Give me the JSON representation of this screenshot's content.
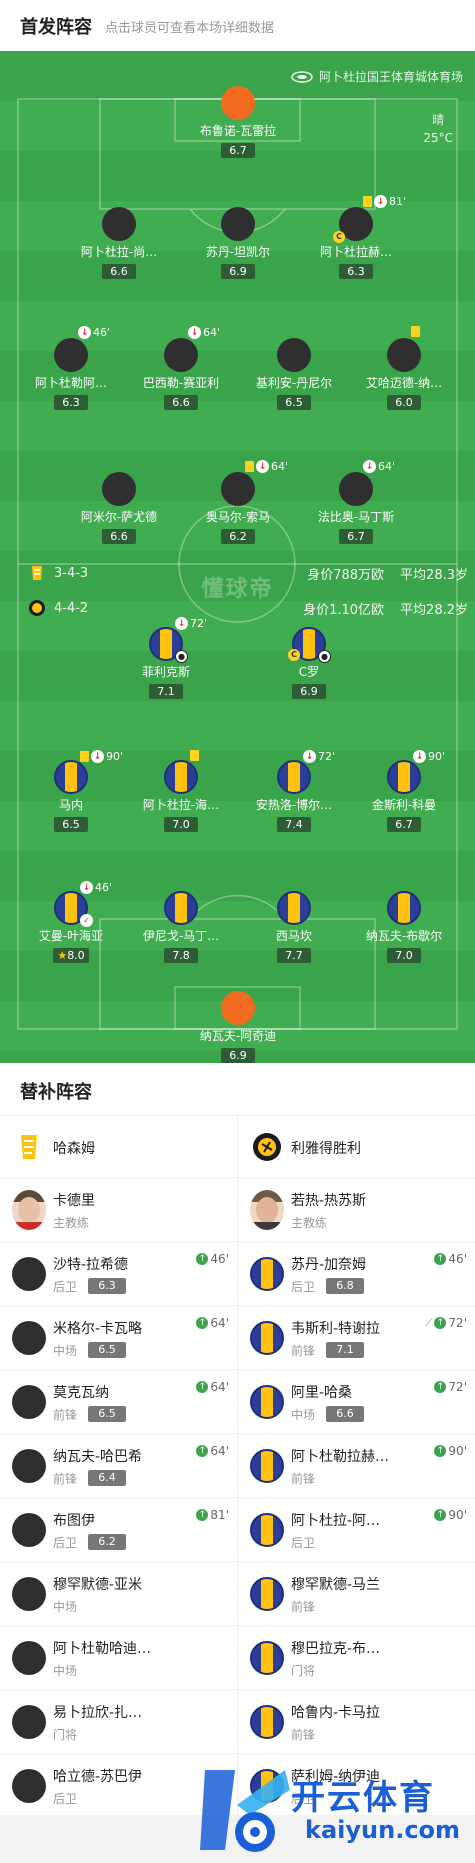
{
  "header": {
    "title": "首发阵容",
    "subtitle": "点击球员可查看本场详细数据"
  },
  "venue": {
    "name": "阿卜杜拉国王体育城体育场"
  },
  "weather": {
    "condition": "晴",
    "temp": "25°C"
  },
  "watermark_mid": "懂球帝",
  "home_team": {
    "formation": "3-4-3",
    "value": "身价788万欧",
    "avg_age": "平均28.3岁"
  },
  "away_team": {
    "formation": "4-4-2",
    "value": "身价1.10亿欧",
    "avg_age": "平均28.2岁"
  },
  "home_players": [
    {
      "name": "布鲁诺-瓦雷拉",
      "rating": "6.7"
    },
    {
      "name": "阿卜杜拉-尚…",
      "rating": "6.6"
    },
    {
      "name": "苏丹-坦凯尔",
      "rating": "6.9"
    },
    {
      "name": "阿卜杜拉赫…",
      "rating": "6.3",
      "event": "81'"
    },
    {
      "name": "阿卜杜勒阿…",
      "rating": "6.3",
      "event": "46'"
    },
    {
      "name": "巴西勒-赛亚利",
      "rating": "6.6",
      "event": "64'"
    },
    {
      "name": "基利安-丹尼尔",
      "rating": "6.5"
    },
    {
      "name": "艾哈迈德-纳…",
      "rating": "6.0"
    },
    {
      "name": "阿米尔-萨尤德",
      "rating": "6.6"
    },
    {
      "name": "奥马尔-索马",
      "rating": "6.2",
      "event": "64'"
    },
    {
      "name": "法比奥-马丁斯",
      "rating": "6.7",
      "event": "64'"
    }
  ],
  "away_players": [
    {
      "name": "菲利克斯",
      "rating": "7.1",
      "event": "72'"
    },
    {
      "name": "C罗",
      "rating": "6.9"
    },
    {
      "name": "马内",
      "rating": "6.5",
      "event": "90'"
    },
    {
      "name": "阿卜杜拉-海…",
      "rating": "7.0"
    },
    {
      "name": "安热洛-博尔…",
      "rating": "7.4",
      "event": "72'"
    },
    {
      "name": "金斯利-科曼",
      "rating": "6.7",
      "event": "90'"
    },
    {
      "name": "艾曼-叶海亚",
      "rating": "8.0",
      "event": "46'"
    },
    {
      "name": "伊尼戈-马丁…",
      "rating": "7.8"
    },
    {
      "name": "西马坎",
      "rating": "7.7"
    },
    {
      "name": "纳瓦夫-布歇尔",
      "rating": "7.0"
    },
    {
      "name": "纳瓦夫-阿奇迪",
      "rating": "6.9"
    }
  ],
  "subs": {
    "title": "替补阵容",
    "left": {
      "team": "哈森姆",
      "coach": {
        "name": "卡德里",
        "role": "主教练"
      },
      "players": [
        {
          "name": "沙特-拉希德",
          "pos": "后卫",
          "rating": "6.3",
          "in": "46'"
        },
        {
          "name": "米格尔-卡瓦略",
          "pos": "中场",
          "rating": "6.5",
          "in": "64'"
        },
        {
          "name": "莫克瓦纳",
          "pos": "前锋",
          "rating": "6.5",
          "in": "64'"
        },
        {
          "name": "纳瓦夫-哈巴希",
          "pos": "前锋",
          "rating": "6.4",
          "in": "64'"
        },
        {
          "name": "布图伊",
          "pos": "后卫",
          "rating": "6.2",
          "in": "81'"
        },
        {
          "name": "穆罕默德-亚米",
          "pos": "中场",
          "rating": "",
          "in": ""
        },
        {
          "name": "阿卜杜勒哈迪…",
          "pos": "中场",
          "rating": "",
          "in": ""
        },
        {
          "name": "易卜拉欣-扎…",
          "pos": "门将",
          "rating": "",
          "in": ""
        },
        {
          "name": "哈立德-苏巴伊",
          "pos": "后卫",
          "rating": "",
          "in": ""
        }
      ]
    },
    "right": {
      "team": "利雅得胜利",
      "coach": {
        "name": "若热-热苏斯",
        "role": "主教练"
      },
      "players": [
        {
          "name": "苏丹-加奈姆",
          "pos": "后卫",
          "rating": "6.8",
          "in": "46'"
        },
        {
          "name": "韦斯利-特谢拉",
          "pos": "前锋",
          "rating": "7.1",
          "in": "72'"
        },
        {
          "name": "阿里-哈桑",
          "pos": "中场",
          "rating": "6.6",
          "in": "72'"
        },
        {
          "name": "阿卜杜勒拉赫…",
          "pos": "前锋",
          "rating": "",
          "in": "90'"
        },
        {
          "name": "阿卜杜拉-阿…",
          "pos": "后卫",
          "rating": "",
          "in": "90'"
        },
        {
          "name": "穆罕默德-马兰",
          "pos": "前锋",
          "rating": "",
          "in": ""
        },
        {
          "name": "穆巴拉克-布…",
          "pos": "门将",
          "rating": "",
          "in": ""
        },
        {
          "name": "哈鲁内-卡马拉",
          "pos": "前锋",
          "rating": "",
          "in": ""
        },
        {
          "name": "萨利姆-纳伊迪",
          "pos": "后卫",
          "rating": "",
          "in": ""
        }
      ]
    }
  },
  "brand": {
    "cn": "开云体育",
    "en": "kaiyun.com"
  },
  "colors": {
    "pitch": "#3aa44a",
    "home_shirt": "#2f2f2f",
    "away_blue": "#2b3f99",
    "away_yellow": "#ffc20e",
    "keeper": "#f36a21"
  }
}
